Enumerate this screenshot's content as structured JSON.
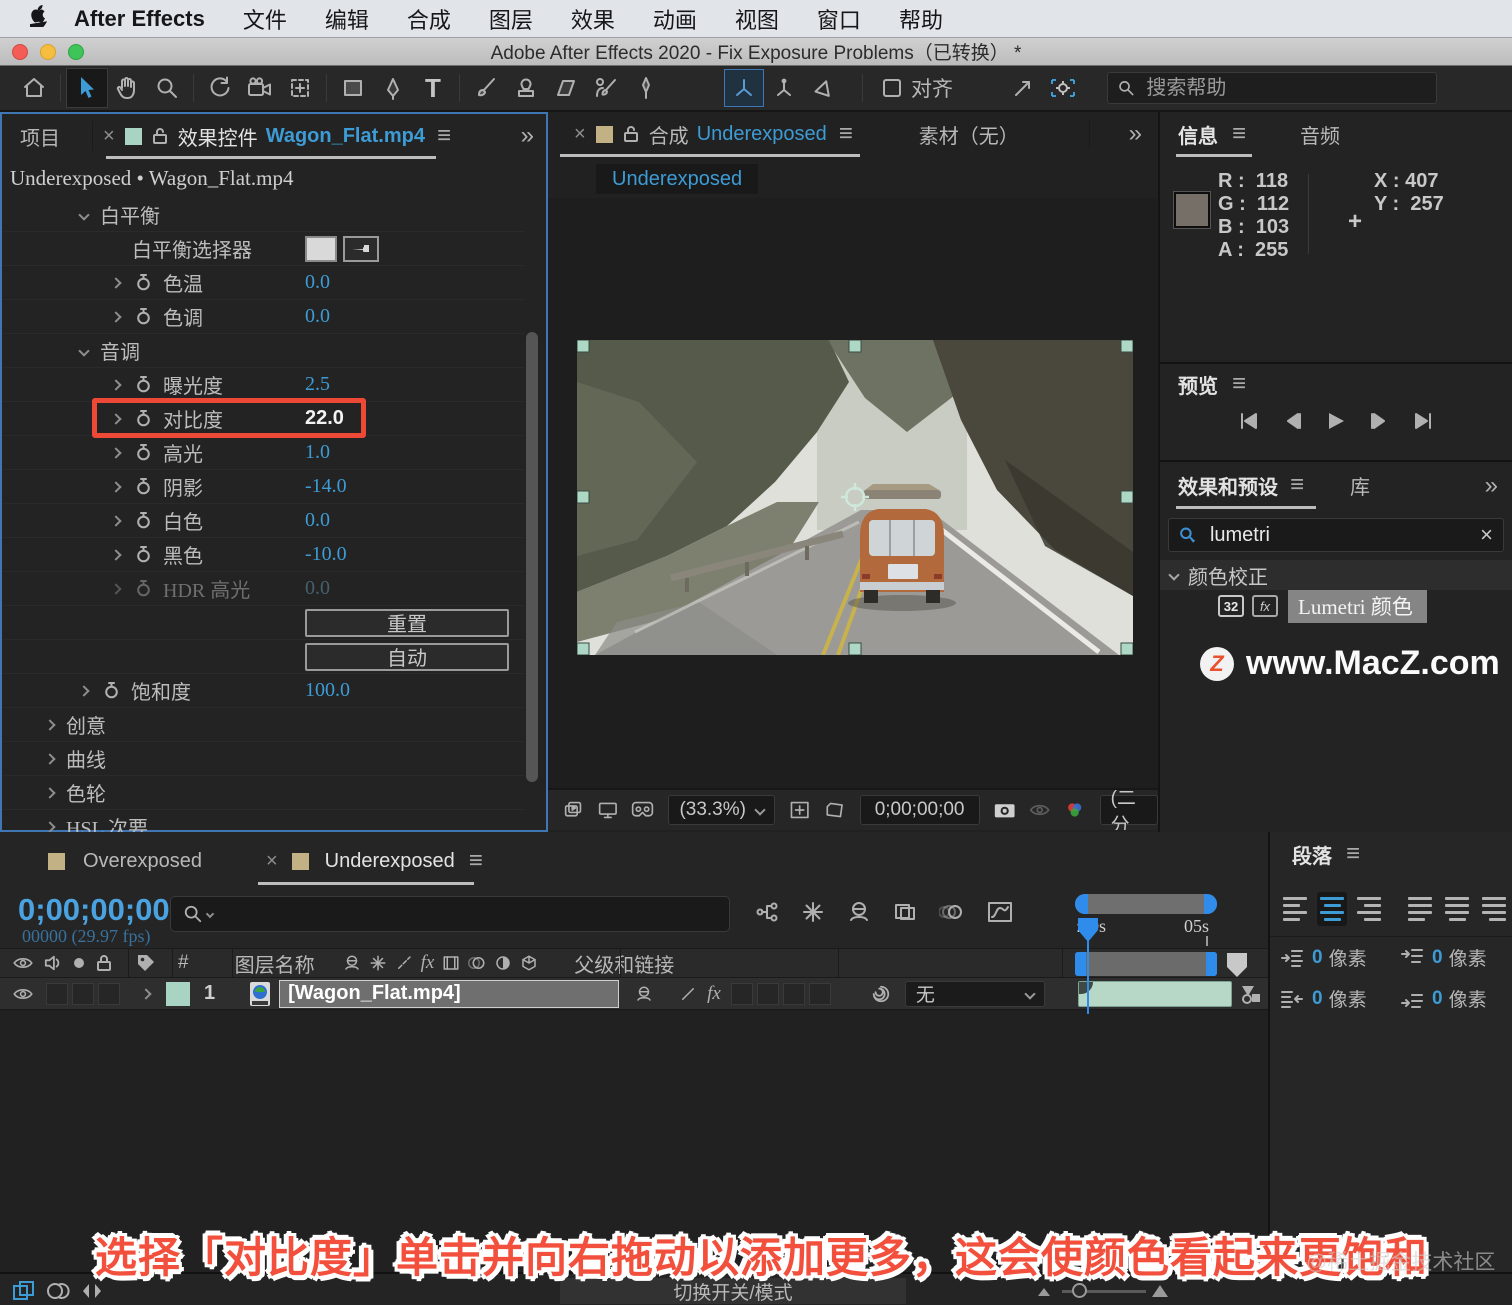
{
  "menubar": {
    "app": "After Effects",
    "items": [
      "文件",
      "编辑",
      "合成",
      "图层",
      "效果",
      "动画",
      "视图",
      "窗口",
      "帮助"
    ]
  },
  "titlebar": {
    "title": "Adobe After Effects 2020 - Fix Exposure Problems（已转换） *"
  },
  "toolbar": {
    "snap_label": "对齐",
    "search_placeholder": "搜索帮助",
    "type_glyph": "T"
  },
  "effect_controls": {
    "tab_project": "项目",
    "panel_label": "效果控件",
    "file_name": "Wagon_Flat.mp4",
    "breadcrumb": "Underexposed • Wagon_Flat.mp4",
    "rows": [
      {
        "label": "白平衡"
      },
      {
        "label": "白平衡选择器"
      },
      {
        "label": "色温",
        "value": "0.0"
      },
      {
        "label": "色调",
        "value": "0.0"
      },
      {
        "label": "音调"
      },
      {
        "label": "曝光度",
        "value": "2.5"
      },
      {
        "label": "对比度",
        "value": "22.0"
      },
      {
        "label": "高光",
        "value": "1.0"
      },
      {
        "label": "阴影",
        "value": "-14.0"
      },
      {
        "label": "白色",
        "value": "0.0"
      },
      {
        "label": "黑色",
        "value": "-10.0"
      },
      {
        "label": "HDR 高光",
        "value": "0.0"
      },
      {
        "label": "重置"
      },
      {
        "label": "自动"
      },
      {
        "label": "饱和度",
        "value": "100.0"
      },
      {
        "label": "创意"
      },
      {
        "label": "曲线"
      },
      {
        "label": "色轮"
      },
      {
        "label": "HSL 次要"
      }
    ]
  },
  "composition": {
    "tab_label": "合成",
    "comp_name": "Underexposed",
    "tab_footage": "素材（无）",
    "comp_dropdown": "Underexposed",
    "zoom_level": "(33.3%)",
    "timecode": "0;00;00;00",
    "resolution": "(二分"
  },
  "info_panel": {
    "tab_info": "信息",
    "tab_audio": "音频",
    "r_label": "R :",
    "r": "118",
    "g_label": "G :",
    "g": "112",
    "b_label": "B :",
    "b": "103",
    "a_label": "A :",
    "a": "255",
    "x_label": "X :",
    "x": "407",
    "y_label": "Y :",
    "y": "257"
  },
  "preview_panel": {
    "title": "预览"
  },
  "effects_presets": {
    "title": "效果和预设",
    "tab_library": "库",
    "search_value": "lumetri",
    "category": "颜色校正",
    "badge": "32",
    "item": "Lumetri 颜色",
    "fx_glyph": "fx"
  },
  "watermark": {
    "logo_letter": "Z",
    "text": "www.MacZ.com"
  },
  "timeline": {
    "tab_overexposed": "Overexposed",
    "tab_underexposed": "Underexposed",
    "timecode": "0;00;00;00",
    "frames": "00000 (29.97 fps)",
    "col_hash": "#",
    "col_layer_name": "图层名称",
    "col_parent": "父级和链接",
    "layer_num": "1",
    "layer_name": "[Wagon_Flat.mp4]",
    "parent_value": "无",
    "ruler_start": ":00s",
    "ruler_end": "05s",
    "fx_glyph": "fx",
    "toggle_button": "切换开关/模式"
  },
  "paragraph_panel": {
    "title": "段落",
    "unit": "像素",
    "indents": [
      {
        "value": "0"
      },
      {
        "value": "0"
      },
      {
        "value": "0"
      },
      {
        "value": "0"
      }
    ]
  },
  "annotation": {
    "text": "选择「对比度」单击并向右拖动以添加更多，这会使颜色看起来更饱和"
  },
  "community_watermark": {
    "text": "@稀土掘金技术社区"
  }
}
